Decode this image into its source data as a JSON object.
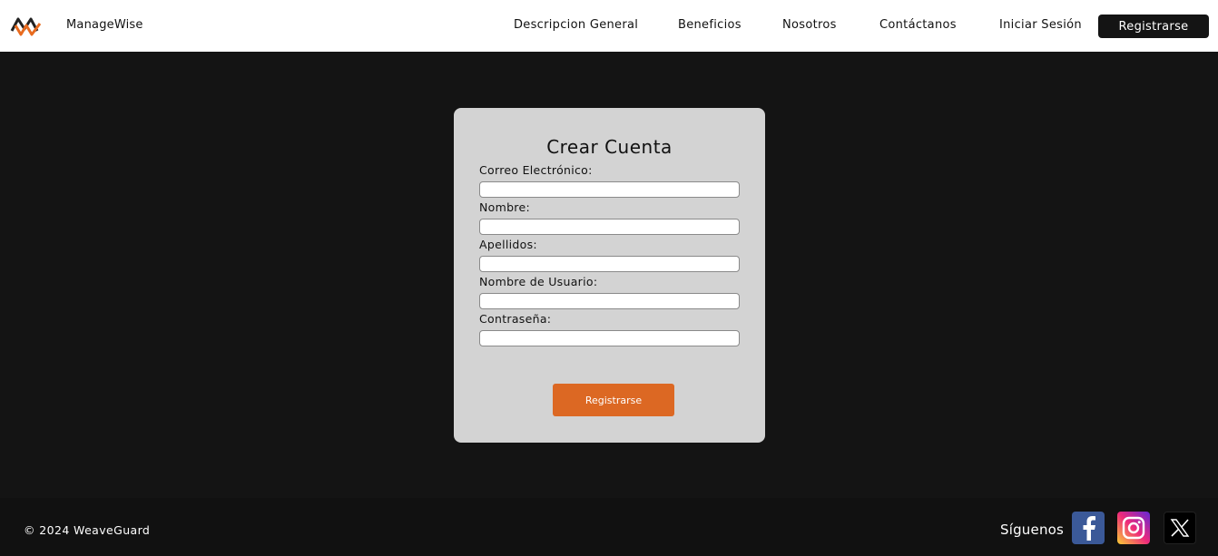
{
  "header": {
    "brand": "ManageWise",
    "nav": [
      {
        "label": "Descripcion General"
      },
      {
        "label": "Beneficios"
      },
      {
        "label": "Nosotros"
      },
      {
        "label": "Contáctanos"
      },
      {
        "label": "Iniciar Sesión"
      }
    ],
    "register_label": "Registrarse"
  },
  "form": {
    "title": "Crear Cuenta",
    "fields": [
      {
        "label": "Correo Electrónico:",
        "value": ""
      },
      {
        "label": "Nombre:",
        "value": ""
      },
      {
        "label": "Apellidos:",
        "value": ""
      },
      {
        "label": "Nombre de Usuario:",
        "value": ""
      },
      {
        "label": "Contraseña:",
        "value": ""
      }
    ],
    "submit_label": "Registrarse"
  },
  "footer": {
    "copyright": "© 2024 WeaveGuard",
    "follow_label": "Síguenos",
    "social": [
      {
        "icon": "facebook-icon"
      },
      {
        "icon": "instagram-icon"
      },
      {
        "icon": "x-icon"
      }
    ]
  },
  "colors": {
    "background": "#141414",
    "card": "#d3d3d3",
    "accent": "#dc6823",
    "header": "#ffffff"
  }
}
